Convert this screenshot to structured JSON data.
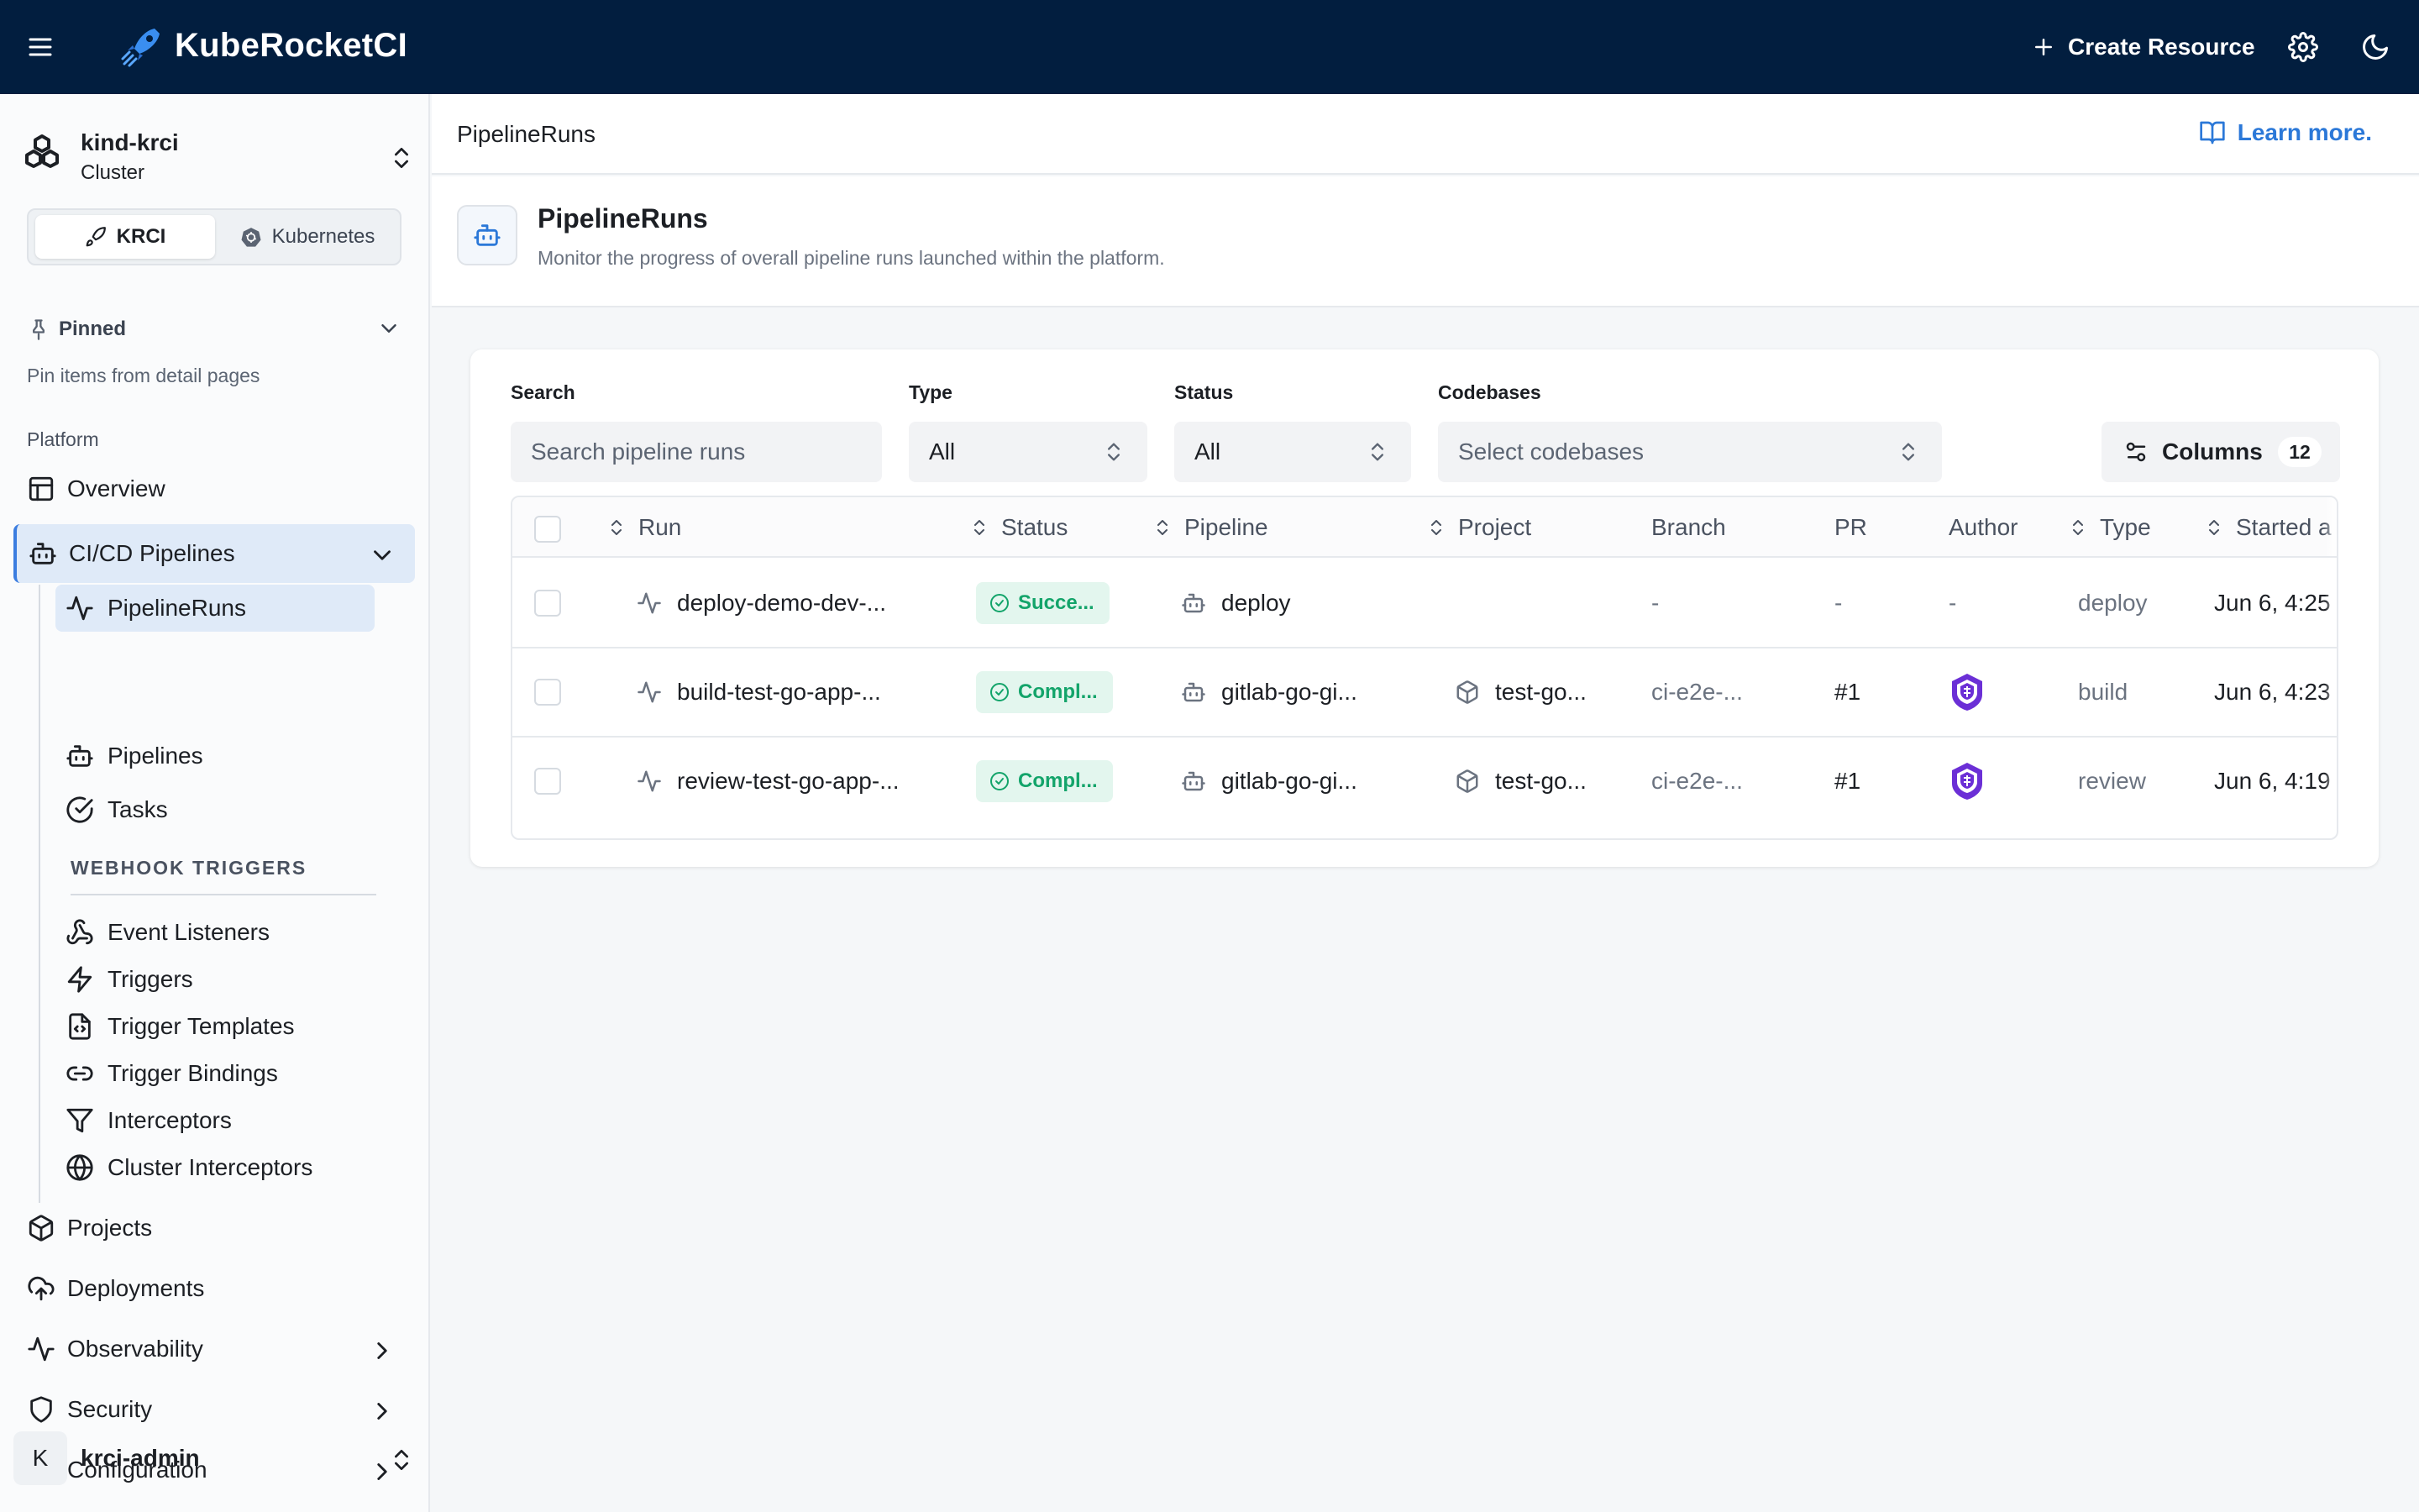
{
  "topbar": {
    "brand": "KubeRocketCI",
    "create_label": "Create Resource"
  },
  "sidebar": {
    "cluster_name": "kind-krci",
    "cluster_type": "Cluster",
    "modes": [
      "KRCI",
      "Kubernetes"
    ],
    "pinned_label": "Pinned",
    "pinned_hint": "Pin items from detail pages",
    "platform_label": "Platform",
    "overview": "Overview",
    "cicd": "CI/CD Pipelines",
    "cicd_items": [
      "PipelineRuns",
      "Pipelines",
      "Tasks"
    ],
    "webhook_label": "WEBHOOK TRIGGERS",
    "webhook_items": [
      "Event Listeners",
      "Triggers",
      "Trigger Templates",
      "Trigger Bindings",
      "Interceptors",
      "Cluster Interceptors"
    ],
    "projects": "Projects",
    "deployments": "Deployments",
    "observability": "Observability",
    "security": "Security",
    "configuration": "Configuration",
    "user_initial": "K",
    "user_name": "krci-admin"
  },
  "breadcrumb": {
    "current": "PipelineRuns",
    "learn_more": "Learn more."
  },
  "page": {
    "title": "PipelineRuns",
    "subtitle": "Monitor the progress of overall pipeline runs launched within the platform."
  },
  "filters": {
    "search_label": "Search",
    "search_placeholder": "Search pipeline runs",
    "type_label": "Type",
    "type_value": "All",
    "status_label": "Status",
    "status_value": "All",
    "codebases_label": "Codebases",
    "codebases_placeholder": "Select codebases",
    "columns_label": "Columns",
    "columns_count": "12"
  },
  "table": {
    "headers": {
      "run": "Run",
      "status": "Status",
      "pipeline": "Pipeline",
      "project": "Project",
      "branch": "Branch",
      "pr": "PR",
      "author": "Author",
      "type": "Type",
      "started": "Started a"
    },
    "rows": [
      {
        "run": "deploy-demo-dev-...",
        "status": "Succe...",
        "pipeline": "deploy",
        "project": "",
        "branch": "-",
        "pr": "-",
        "author": "-",
        "type": "deploy",
        "started": "Jun 6, 4:25"
      },
      {
        "run": "build-test-go-app-...",
        "status": "Compl...",
        "pipeline": "gitlab-go-gi...",
        "project": "test-go...",
        "branch": "ci-e2e-...",
        "pr": "#1",
        "author": "avatar",
        "type": "build",
        "started": "Jun 6, 4:23"
      },
      {
        "run": "review-test-go-app-...",
        "status": "Compl...",
        "pipeline": "gitlab-go-gi...",
        "project": "test-go...",
        "branch": "ci-e2e-...",
        "pr": "#1",
        "author": "avatar",
        "type": "review",
        "started": "Jun 6, 4:19"
      }
    ]
  },
  "colors": {
    "topbar": "#021e3f",
    "accent": "#2b78d8",
    "success": "#13a46a",
    "avatar": "#6b2fd6"
  }
}
